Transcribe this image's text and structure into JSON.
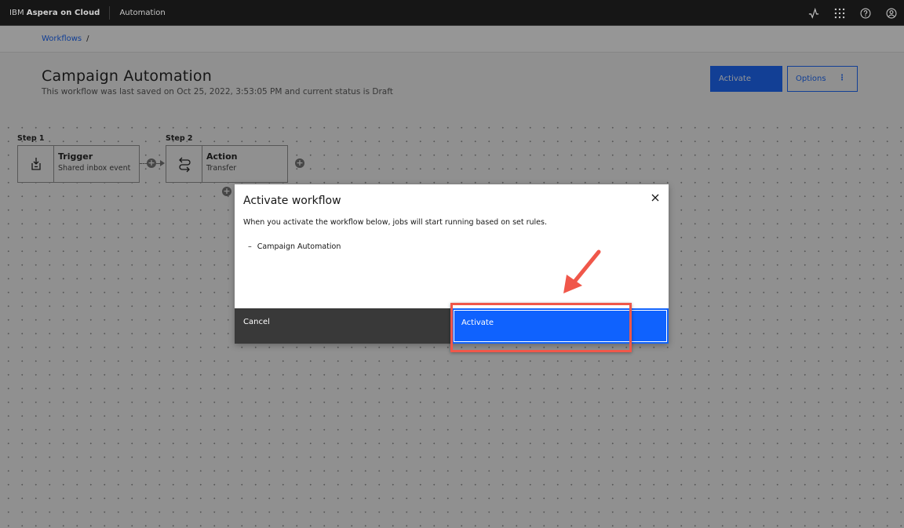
{
  "topnav": {
    "brand_prefix": "IBM",
    "brand_name": "Aspera on Cloud",
    "app_name": "Automation",
    "icons": [
      "activity-icon",
      "app-switcher-icon",
      "help-icon",
      "user-avatar-icon"
    ]
  },
  "breadcrumb": {
    "items": [
      {
        "label": "Workflows"
      }
    ],
    "separator": "/"
  },
  "header": {
    "title": "Campaign Automation",
    "subtitle": "This workflow was last saved on Oct 25, 2022, 3:53:05 PM and current status is Draft",
    "activate_label": "Activate",
    "options_label": "Options",
    "options_icon": "⋮"
  },
  "canvas": {
    "steps": [
      {
        "step_label": "Step 1",
        "title": "Trigger",
        "description": "Shared inbox event",
        "icon": "inbox-download-icon"
      },
      {
        "step_label": "Step 2",
        "title": "Action",
        "description": "Transfer",
        "icon": "transfer-arrows-icon"
      }
    ],
    "add_symbol": "+"
  },
  "modal": {
    "title": "Activate workflow",
    "body": "When you activate the workflow below, jobs will start running based on set rules.",
    "list_dash": "–",
    "list_items": [
      "Campaign Automation"
    ],
    "cancel_label": "Cancel",
    "activate_label": "Activate",
    "close_icon": "close-icon"
  },
  "colors": {
    "primary": "#0f62fe",
    "nav_bg": "#161616",
    "secondary_button": "#393939",
    "annotation": "#f0574a"
  }
}
